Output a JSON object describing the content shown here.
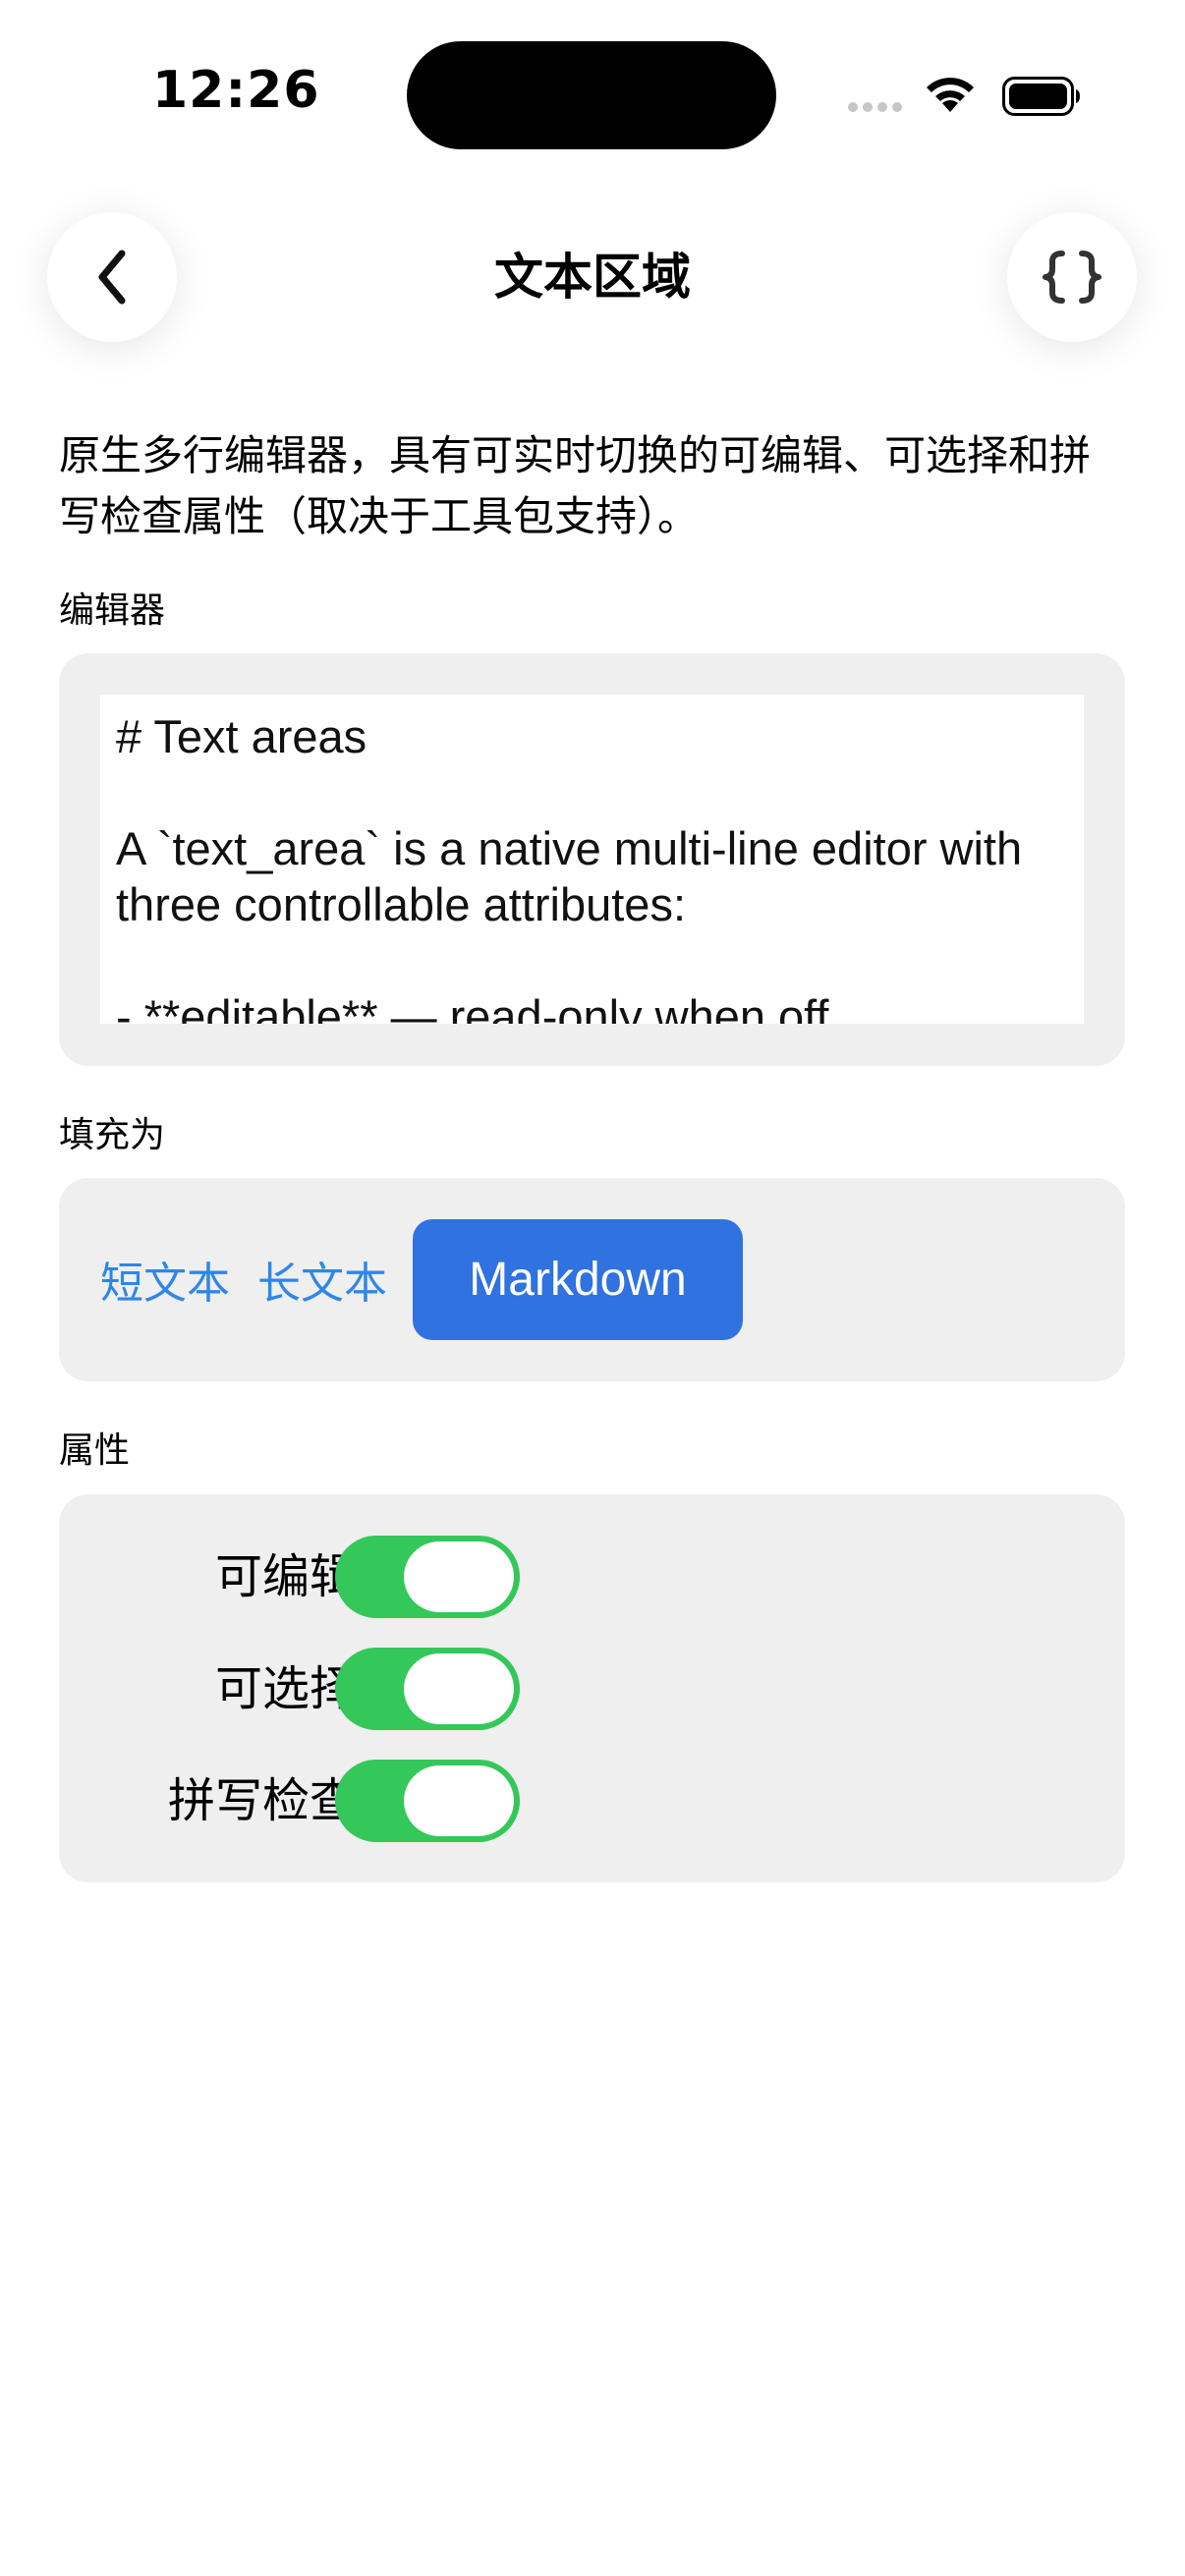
{
  "status_bar": {
    "time": "12:26"
  },
  "header": {
    "title": "文本区域",
    "back_icon": "chevron-left-icon",
    "code_icon": "braces-icon"
  },
  "description": "原生多行编辑器，具有可实时切换的可编辑、可选择和拼写检查属性（取决于工具包支持）。",
  "editor": {
    "label": "编辑器",
    "value": "# Text areas\n\nA `text_area` is a native multi-line editor with three controllable attributes:\n\n- **editable** — read-only when off"
  },
  "fill": {
    "label": "填充为",
    "options": [
      "短文本",
      "长文本",
      "Markdown"
    ],
    "selected": "Markdown"
  },
  "attributes": {
    "label": "属性",
    "items": [
      {
        "label": "可编辑",
        "on": true
      },
      {
        "label": "可选择",
        "on": true
      },
      {
        "label": "拼写检查",
        "on": true
      }
    ]
  },
  "colors": {
    "accent": "#2f72e0",
    "link": "#2f86e8",
    "toggle_on": "#34c759",
    "card_bg": "#efefef"
  }
}
